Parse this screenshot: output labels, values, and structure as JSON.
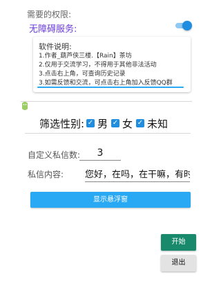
{
  "permissions": {
    "title": "需要的权限:",
    "accessibility_label": "无障碍服务:",
    "accessibility_enabled": true
  },
  "notice": {
    "title": "软件说明:",
    "lines": [
      "1.作者_葫芦侠三楼.【Rain】茶坊",
      "2.仅用于交流学习，不得用于其他非法活动",
      "3.点击右上角，可查询历史记录",
      "3.如需反馈和交流，可点击右上角加入反馈QQ群"
    ]
  },
  "gender_filter": {
    "label": "筛选性别:",
    "options": [
      {
        "label": "男",
        "checked": true
      },
      {
        "label": "女",
        "checked": true
      },
      {
        "label": "未知",
        "checked": true
      }
    ]
  },
  "custom_count": {
    "label": "自定义私信数:",
    "value": "3"
  },
  "message": {
    "label": "私信内容:",
    "value": "您好，在吗，在干嘛，有时间吗?"
  },
  "buttons": {
    "show_float": "显示悬浮窗",
    "start": "开始",
    "exit": "退出"
  },
  "colors": {
    "accent": "#29a8f3",
    "purple_label": "#6a3cd8",
    "start_green": "#188a6b"
  }
}
